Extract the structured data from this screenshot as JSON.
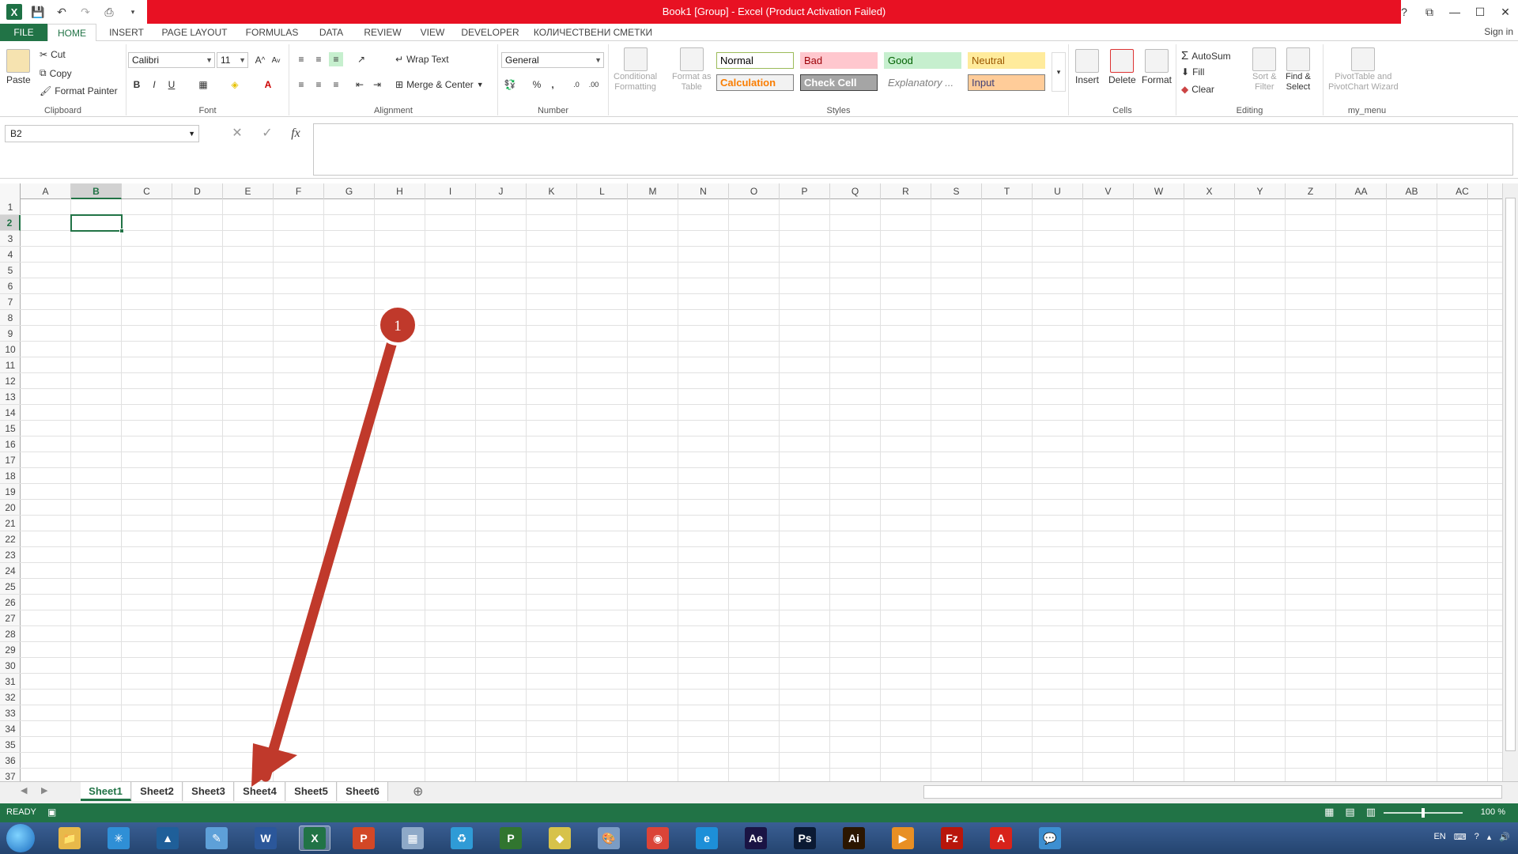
{
  "window": {
    "title": "Book1  [Group] - Excel (Product Activation Failed)",
    "accent_color": "#217346",
    "titlebar_color": "#e81123",
    "controls": [
      "?",
      "⧉",
      "—",
      "☐",
      "✕"
    ]
  },
  "qat": {
    "icons": [
      "excel-logo-icon",
      "save-icon",
      "undo-icon",
      "redo-icon",
      "print-preview-icon",
      "customize-icon"
    ]
  },
  "ribbon": {
    "tabs": [
      "FILE",
      "HOME",
      "INSERT",
      "PAGE LAYOUT",
      "FORMULAS",
      "DATA",
      "REVIEW",
      "VIEW",
      "DEVELOPER",
      "КОЛИЧЕСТВЕНИ СМЕТКИ"
    ],
    "active_tab": "HOME",
    "sign_in": "Sign in",
    "clipboard": {
      "label": "Clipboard",
      "paste": "Paste",
      "cut": "Cut",
      "copy": "Copy",
      "format_painter": "Format Painter"
    },
    "font": {
      "label": "Font",
      "name": "Calibri",
      "size": "11",
      "bold": "B",
      "italic": "I",
      "underline": "U"
    },
    "alignment": {
      "label": "Alignment",
      "wrap_text": "Wrap Text",
      "merge_center": "Merge & Center"
    },
    "number": {
      "label": "Number",
      "format": "General",
      "percent": "%",
      "comma": ","
    },
    "styles": {
      "label": "Styles",
      "conditional": "Conditional",
      "conditional2": "Formatting",
      "format_as": "Format as",
      "table": "Table",
      "cells": [
        {
          "name": "Normal",
          "bg": "#ffffff",
          "fg": "#000000",
          "border": "#9bbb59"
        },
        {
          "name": "Bad",
          "bg": "#ffc7ce",
          "fg": "#9c0006",
          "border": "#ffc7ce"
        },
        {
          "name": "Good",
          "bg": "#c6efce",
          "fg": "#006100",
          "border": "#c6efce"
        },
        {
          "name": "Neutral",
          "bg": "#ffeb9c",
          "fg": "#9c5700",
          "border": "#ffeb9c"
        },
        {
          "name": "Calculation",
          "bg": "#f2f2f2",
          "fg": "#fa7d00",
          "border": "#7f7f7f"
        },
        {
          "name": "Check Cell",
          "bg": "#a5a5a5",
          "fg": "#ffffff",
          "border": "#3f3f3f"
        },
        {
          "name": "Explanatory ...",
          "bg": "#ffffff",
          "fg": "#7f7f7f",
          "border": "#ffffff"
        },
        {
          "name": "Input",
          "bg": "#ffcc99",
          "fg": "#3f3f76",
          "border": "#7f7f7f"
        }
      ]
    },
    "cells_group": {
      "label": "Cells",
      "insert": "Insert",
      "delete": "Delete",
      "format": "Format"
    },
    "editing": {
      "label": "Editing",
      "autosum": "AutoSum",
      "fill": "Fill",
      "clear": "Clear",
      "sort": "Sort &",
      "sort2": "Filter",
      "find": "Find &",
      "find2": "Select"
    },
    "my_menu": {
      "label": "my_menu",
      "pivot": "PivotTable and",
      "pivot2": "PivotChart Wizard"
    }
  },
  "formula_bar": {
    "name_box": "B2",
    "fx": "fx",
    "value": ""
  },
  "grid": {
    "columns": [
      "A",
      "B",
      "C",
      "D",
      "E",
      "F",
      "G",
      "H",
      "I",
      "J",
      "K",
      "L",
      "M",
      "N",
      "O",
      "P",
      "Q",
      "R",
      "S",
      "T",
      "U",
      "V",
      "W",
      "X",
      "Y",
      "Z",
      "AA",
      "AB",
      "AC"
    ],
    "rows": [
      "1",
      "2",
      "3",
      "4",
      "5",
      "6",
      "7",
      "8",
      "9",
      "10",
      "11",
      "12",
      "13",
      "14",
      "15",
      "16",
      "17",
      "18",
      "19",
      "20",
      "21",
      "22",
      "23",
      "24",
      "25",
      "26",
      "27",
      "28",
      "29",
      "30",
      "31",
      "32",
      "33",
      "34",
      "35",
      "36",
      "37"
    ],
    "selected_column": "B",
    "selected_row": "2"
  },
  "sheets": {
    "tabs": [
      "Sheet1",
      "Sheet2",
      "Sheet3",
      "Sheet4",
      "Sheet5",
      "Sheet6"
    ],
    "active": "Sheet1",
    "add": "⊕"
  },
  "status": {
    "ready": "READY",
    "zoom": "100 %",
    "zoom_fraction": 0.5
  },
  "annotation": {
    "marker": "1",
    "color": "#c0392b"
  },
  "taskbar": {
    "apps": [
      {
        "icon": "explorer-icon",
        "glyph": "📁",
        "bg": "#e8b94a"
      },
      {
        "icon": "network-icon",
        "glyph": "✳",
        "bg": "#2f8fd6"
      },
      {
        "icon": "autocad-icon",
        "glyph": "▲",
        "bg": "#1f5f99"
      },
      {
        "icon": "notepad-icon",
        "glyph": "✎",
        "bg": "#5ea0d8"
      },
      {
        "icon": "word-icon",
        "glyph": "W",
        "bg": "#2b579a"
      },
      {
        "icon": "excel-icon",
        "glyph": "X",
        "bg": "#217346",
        "active": true
      },
      {
        "icon": "powerpoint-icon",
        "glyph": "P",
        "bg": "#d24726"
      },
      {
        "icon": "calculator-icon",
        "glyph": "▦",
        "bg": "#8ea9c8"
      },
      {
        "icon": "recycle-icon",
        "glyph": "♻",
        "bg": "#2f9bd6"
      },
      {
        "icon": "project-icon",
        "glyph": "P",
        "bg": "#31752f"
      },
      {
        "icon": "folder-icon",
        "glyph": "◆",
        "bg": "#d7c24a"
      },
      {
        "icon": "paint-icon",
        "glyph": "🎨",
        "bg": "#7b9cc4"
      },
      {
        "icon": "chrome-icon",
        "glyph": "◉",
        "bg": "#db4437"
      },
      {
        "icon": "ie-icon",
        "glyph": "e",
        "bg": "#1d8fd8"
      },
      {
        "icon": "after-effects-icon",
        "glyph": "Ae",
        "bg": "#1a1444"
      },
      {
        "icon": "photoshop-icon",
        "glyph": "Ps",
        "bg": "#0b1a33"
      },
      {
        "icon": "illustrator-icon",
        "glyph": "Ai",
        "bg": "#2b1600"
      },
      {
        "icon": "media-player-icon",
        "glyph": "▶",
        "bg": "#e88f24"
      },
      {
        "icon": "filezilla-icon",
        "glyph": "Fz",
        "bg": "#b8160b"
      },
      {
        "icon": "acrobat-icon",
        "glyph": "A",
        "bg": "#d8231b"
      },
      {
        "icon": "chat-icon",
        "glyph": "💬",
        "bg": "#3d8fd1"
      }
    ],
    "lang": "EN"
  }
}
